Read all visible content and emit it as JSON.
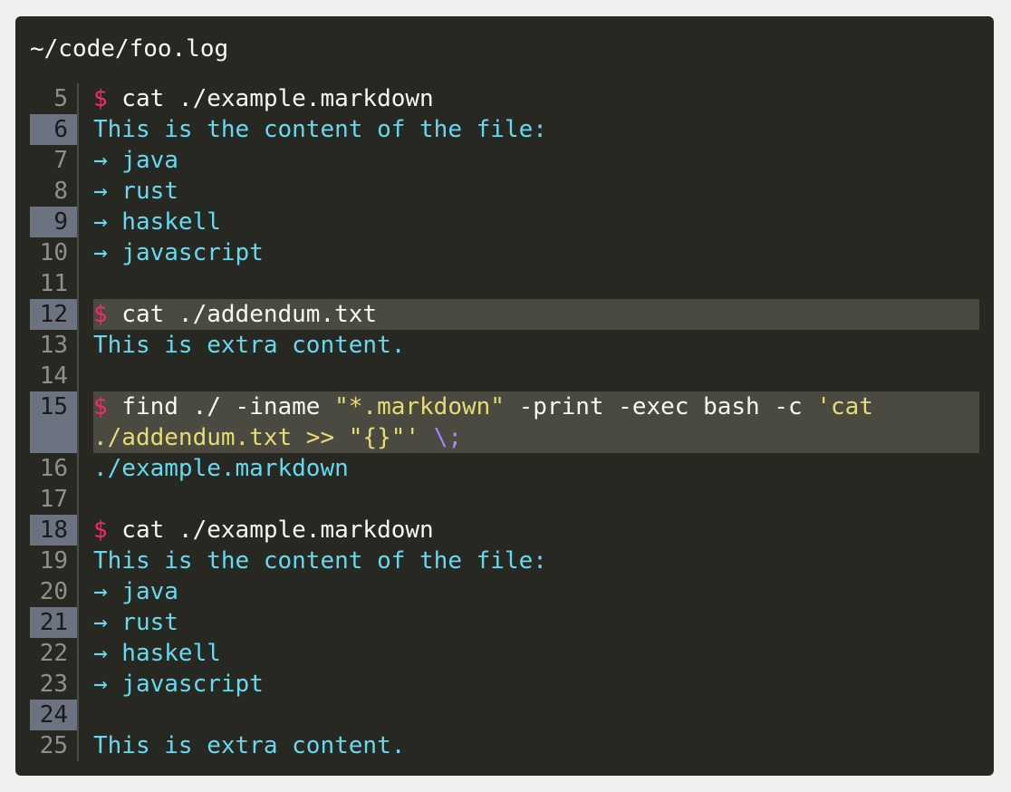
{
  "window": {
    "title": "~/code/foo.log"
  },
  "lines": [
    {
      "num": "5",
      "prompt": "$",
      "cmd": " cat ./example.markdown"
    },
    {
      "num": "6",
      "out": "This is the content of the file:"
    },
    {
      "num": "7",
      "out": "→ java"
    },
    {
      "num": "8",
      "out": "→ rust"
    },
    {
      "num": "9",
      "out": "→ haskell"
    },
    {
      "num": "10",
      "out": "→ javascript"
    },
    {
      "num": "11",
      "out": ""
    },
    {
      "num": "12",
      "prompt": "$",
      "cmd": " cat ./addendum.txt"
    },
    {
      "num": "13",
      "out": "This is extra content."
    },
    {
      "num": "14",
      "out": ""
    },
    {
      "num": "15",
      "prompt": "$",
      "cmd_a": " find ./ -iname ",
      "str_a": "\"*.markdown\"",
      "cmd_b": " -print -exec bash -c ",
      "str_b": "'cat",
      "str_c": "./addendum.txt >> \"{}\"'",
      "cmd_c": " ",
      "esc": "\\;"
    },
    {
      "num": "16",
      "out": "./example.markdown"
    },
    {
      "num": "17",
      "out": ""
    },
    {
      "num": "18",
      "prompt": "$",
      "cmd": " cat ./example.markdown"
    },
    {
      "num": "19",
      "out": "This is the content of the file:"
    },
    {
      "num": "20",
      "out": "→ java"
    },
    {
      "num": "21",
      "out": "→ rust"
    },
    {
      "num": "22",
      "out": "→ haskell"
    },
    {
      "num": "23",
      "out": "→ javascript"
    },
    {
      "num": "24",
      "out": ""
    },
    {
      "num": "25",
      "out": "This is extra content."
    }
  ],
  "colors": {
    "background": "#272822",
    "prompt": "#f92672",
    "output": "#66d9ef",
    "string": "#e6db74",
    "escape": "#ae81ff",
    "highlighted_gutter": "#6b7280",
    "active_line": "#4a4a40"
  }
}
